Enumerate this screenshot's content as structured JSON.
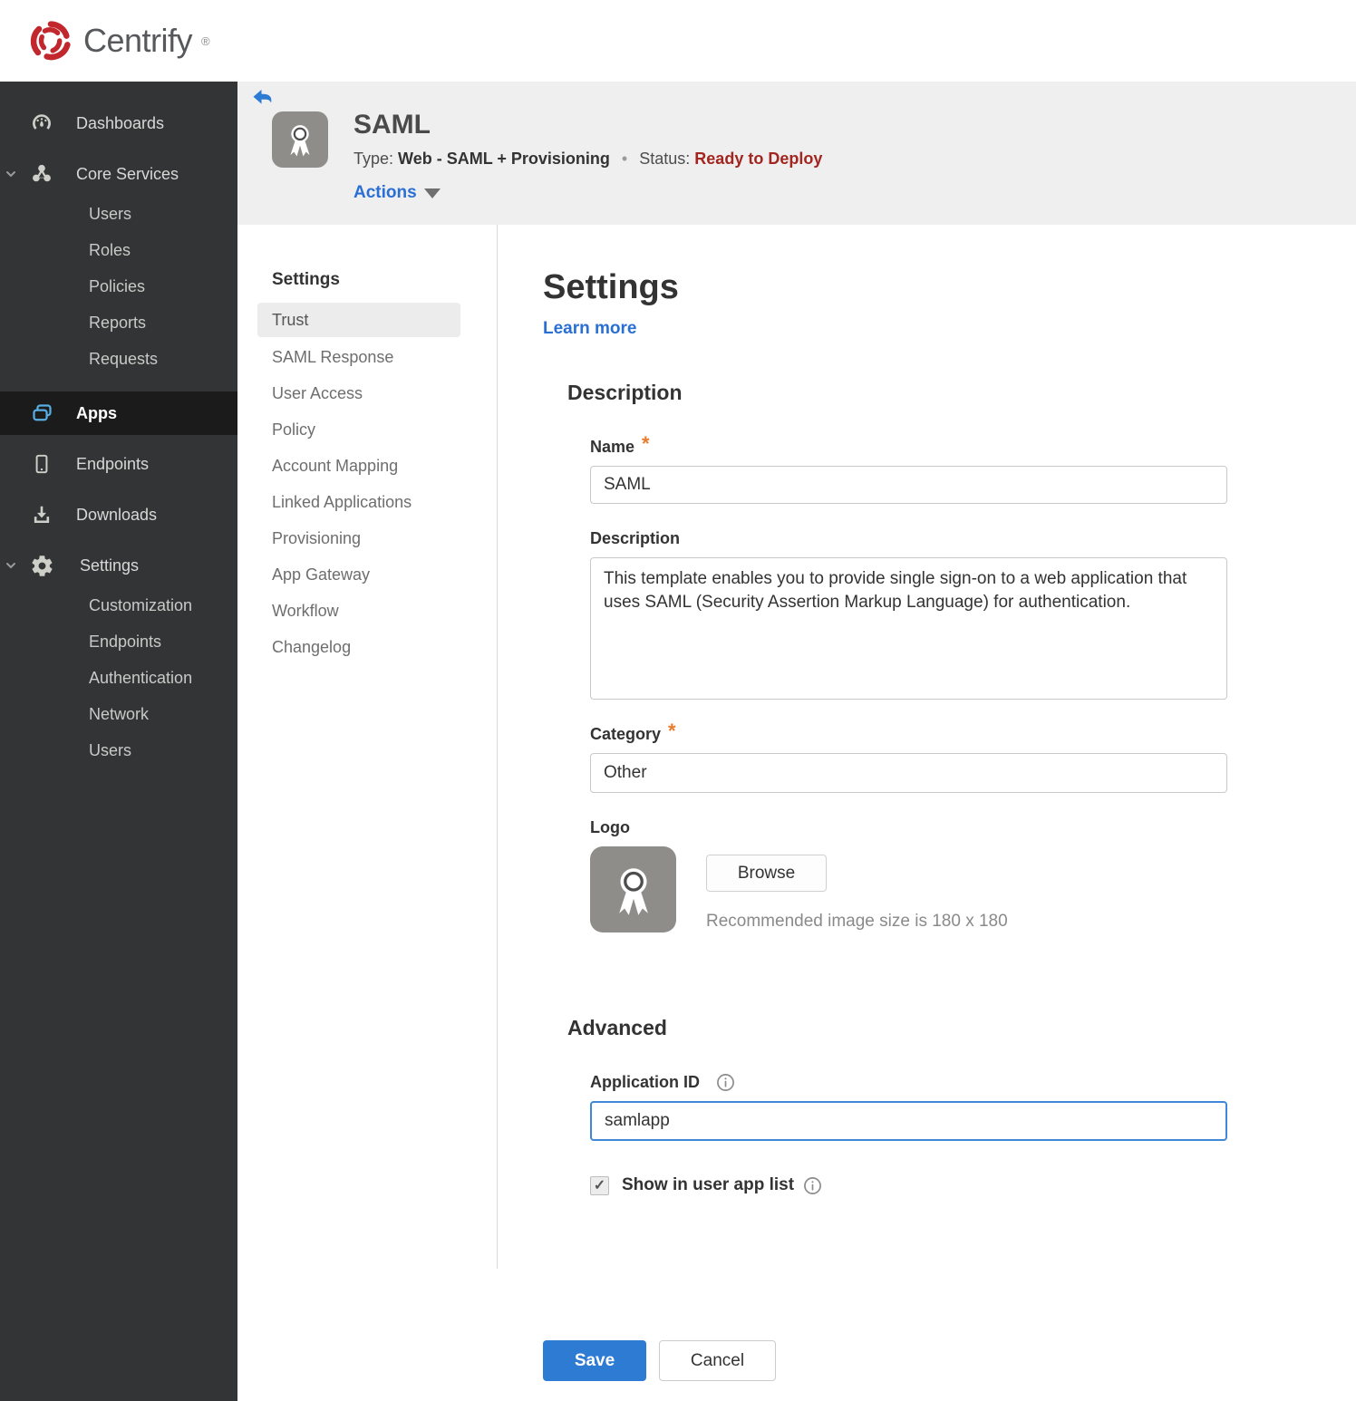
{
  "brand": {
    "name": "Centrify",
    "registered": "®"
  },
  "colors": {
    "brand_red": "#c1272d",
    "accent_blue": "#2e7bd4",
    "link_blue": "#2a6fd4",
    "status_red": "#a3251f",
    "asterisk_orange": "#e87c2b",
    "sidebar_bg": "#333436",
    "sidebar_active_bg": "#1b1b1b",
    "header_bg": "#efefef",
    "focus_border": "#3f87d8"
  },
  "sidebar": {
    "items": [
      {
        "label": "Dashboards"
      },
      {
        "label": "Core Services",
        "children": [
          "Users",
          "Roles",
          "Policies",
          "Reports",
          "Requests"
        ]
      },
      {
        "label": "Apps",
        "active": true
      },
      {
        "label": "Endpoints"
      },
      {
        "label": "Downloads"
      },
      {
        "label": "Settings",
        "children": [
          "Customization",
          "Endpoints",
          "Authentication",
          "Network",
          "Users"
        ]
      }
    ]
  },
  "header": {
    "app_name": "SAML",
    "type_label": "Type:",
    "type_value": "Web - SAML + Provisioning",
    "separator": "•",
    "status_label": "Status:",
    "status_value": "Ready to Deploy",
    "actions_label": "Actions"
  },
  "subnav": {
    "heading": "Settings",
    "active_item": "Trust",
    "items": [
      "Trust",
      "SAML Response",
      "User Access",
      "Policy",
      "Account Mapping",
      "Linked Applications",
      "Provisioning",
      "App Gateway",
      "Workflow",
      "Changelog"
    ]
  },
  "main": {
    "title": "Settings",
    "learn_more": "Learn more",
    "required_marker": "*",
    "description": {
      "heading": "Description",
      "name_label": "Name",
      "name_value": "SAML",
      "description_label": "Description",
      "description_value": "This template enables you to provide single sign-on to a web application that uses SAML (Security Assertion Markup Language) for authentication.",
      "category_label": "Category",
      "category_value": "Other",
      "logo_label": "Logo",
      "browse_label": "Browse",
      "logo_hint": "Recommended image size is 180 x 180"
    },
    "advanced": {
      "heading": "Advanced",
      "app_id_label": "Application ID",
      "app_id_value": "samlapp",
      "show_label": "Show in user app list",
      "checkbox_checked": "✓"
    },
    "actions": {
      "save": "Save",
      "cancel": "Cancel"
    }
  }
}
